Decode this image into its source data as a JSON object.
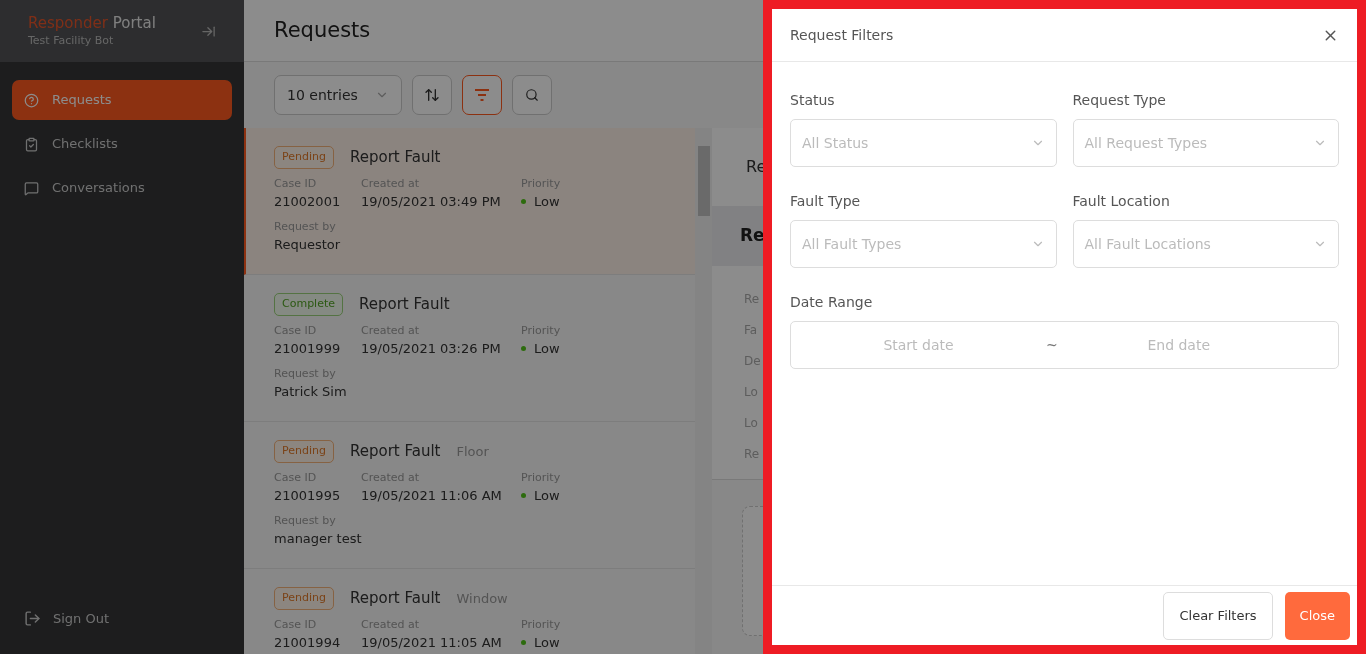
{
  "sidebar": {
    "brand_first": "Responder",
    "brand_second": "Portal",
    "subtitle": "Test Facility Bot",
    "items": [
      {
        "label": "Requests",
        "selected": true
      },
      {
        "label": "Checklists",
        "selected": false
      },
      {
        "label": "Conversations",
        "selected": false
      }
    ],
    "sign_out": "Sign Out"
  },
  "page_title": "Requests",
  "toolbar": {
    "entries": "10 entries",
    "filter_active": true
  },
  "requests": [
    {
      "status": "Pending",
      "kind": "pending",
      "title": "Report Fault",
      "selected": true,
      "case_label": "Case ID",
      "case_id": "21002001",
      "created_label": "Created at",
      "created": "19/05/2021 03:49 PM",
      "priority_label": "Priority",
      "priority": "Low",
      "by_label": "Request by",
      "by": "Requestor"
    },
    {
      "status": "Complete",
      "kind": "complete",
      "title": "Report Fault",
      "selected": false,
      "case_label": "Case ID",
      "case_id": "21001999",
      "created_label": "Created at",
      "created": "19/05/2021 03:26 PM",
      "priority_label": "Priority",
      "priority": "Low",
      "by_label": "Request by",
      "by": "Patrick Sim"
    },
    {
      "status": "Pending",
      "kind": "pending",
      "title": "Report Fault",
      "category": "Floor",
      "selected": false,
      "case_label": "Case ID",
      "case_id": "21001995",
      "created_label": "Created at",
      "created": "19/05/2021 11:06 AM",
      "priority_label": "Priority",
      "priority": "Low",
      "by_label": "Request by",
      "by": "manager test"
    },
    {
      "status": "Pending",
      "kind": "pending",
      "title": "Report Fault",
      "category": "Window",
      "selected": false,
      "case_label": "Case ID",
      "case_id": "21001994",
      "created_label": "Created at",
      "created": "19/05/2021 11:05 AM",
      "priority_label": "Priority",
      "priority": "Low"
    }
  ],
  "detail_panel": {
    "tab": "Re",
    "heading": "Re",
    "labels": [
      "Re",
      "Fa",
      "De",
      "Lo",
      "Lo",
      "Re"
    ]
  },
  "filters": {
    "title": "Request Filters",
    "fields": [
      {
        "label": "Status",
        "placeholder": "All Status"
      },
      {
        "label": "Request Type",
        "placeholder": "All Request Types"
      },
      {
        "label": "Fault Type",
        "placeholder": "All Fault Types"
      },
      {
        "label": "Fault Location",
        "placeholder": "All Fault Locations"
      }
    ],
    "date_range": {
      "label": "Date Range",
      "start_placeholder": "Start date",
      "separator": "~",
      "end_placeholder": "End date"
    },
    "buttons": [
      "Clear Filters",
      "Close"
    ]
  }
}
